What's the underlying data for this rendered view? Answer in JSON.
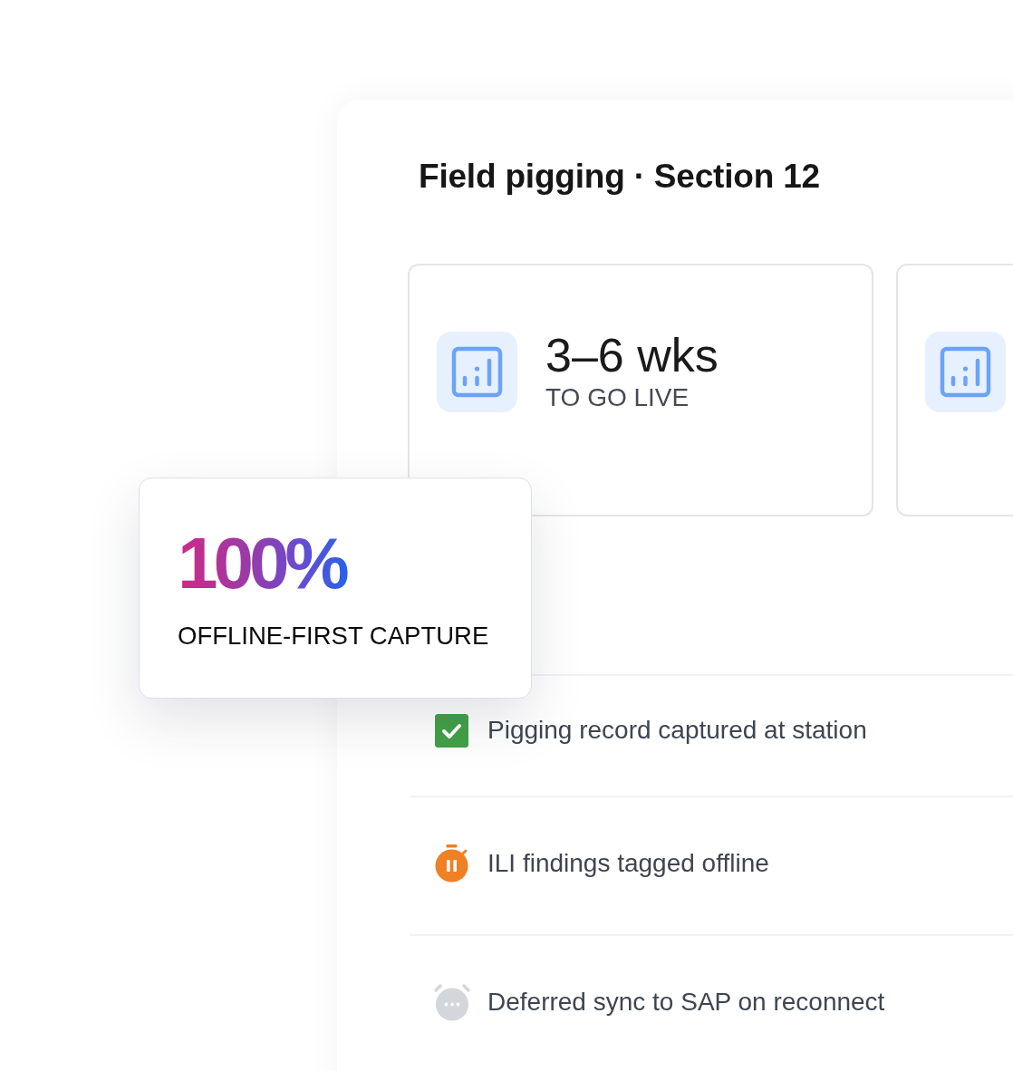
{
  "panel": {
    "title": "Field pigging · Section 12"
  },
  "stat_cards": [
    {
      "kind": "stat",
      "value": "3–6 wks",
      "label": "TO GO LIVE"
    },
    {
      "kind": "cut_off"
    }
  ],
  "highlight_card": {
    "value": "100%",
    "label": "OFFLINE-FIRST CAPTURE"
  },
  "checklist": [
    {
      "kind": "done",
      "text": "Pigging record captured at station"
    },
    {
      "kind": "paused",
      "text": "ILI findings tagged offline"
    },
    {
      "kind": "pending",
      "text": "Deferred sync to SAP on reconnect"
    }
  ]
}
